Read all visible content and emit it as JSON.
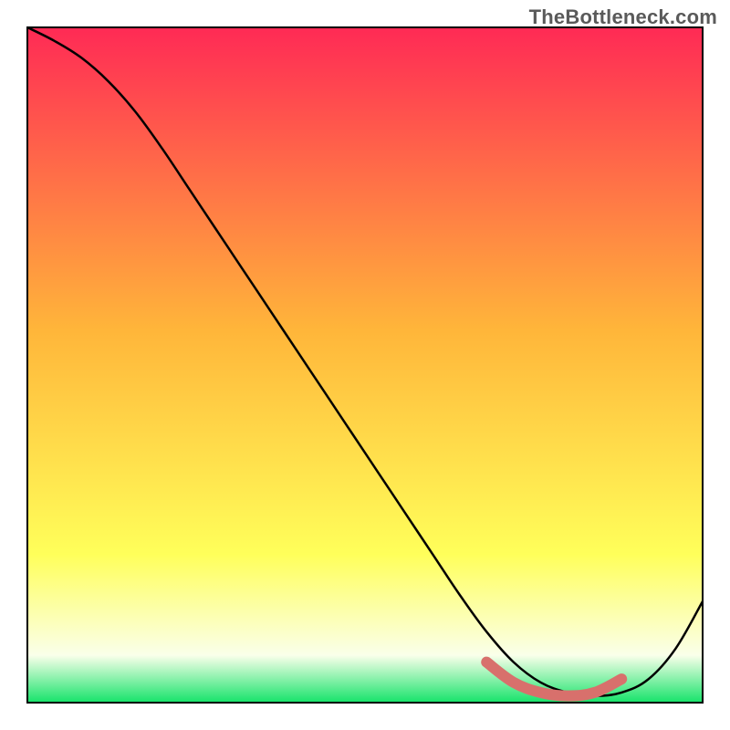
{
  "attribution": "TheBottleneck.com",
  "colors": {
    "gradient_top": "#ff2a55",
    "gradient_mid": "#ffb63a",
    "gradient_yellow": "#ffff5a",
    "gradient_pale": "#faffea",
    "gradient_bottom": "#16e36a",
    "curve_black": "#000000",
    "curve_highlight": "#d8706c",
    "frame": "#000000"
  },
  "chart_data": {
    "type": "line",
    "title": "",
    "xlabel": "",
    "ylabel": "",
    "xlim": [
      0,
      100
    ],
    "ylim": [
      0,
      100
    ],
    "x": [
      0,
      4,
      8,
      12,
      16,
      20,
      24,
      28,
      32,
      36,
      40,
      44,
      48,
      52,
      56,
      60,
      64,
      68,
      72,
      76,
      80,
      84,
      88,
      92,
      96,
      100
    ],
    "values": [
      100,
      98,
      95.5,
      92,
      87.5,
      82,
      76,
      70,
      64,
      58,
      52,
      46,
      40,
      34,
      28,
      22,
      16,
      10.5,
      6,
      3,
      1.5,
      1,
      1.5,
      3.5,
      8,
      15
    ],
    "highlight": {
      "x": [
        68,
        72,
        76,
        80,
        84,
        88
      ],
      "values": [
        6,
        3,
        1.5,
        1,
        1.5,
        3.5
      ]
    },
    "grid": false,
    "legend": false
  }
}
